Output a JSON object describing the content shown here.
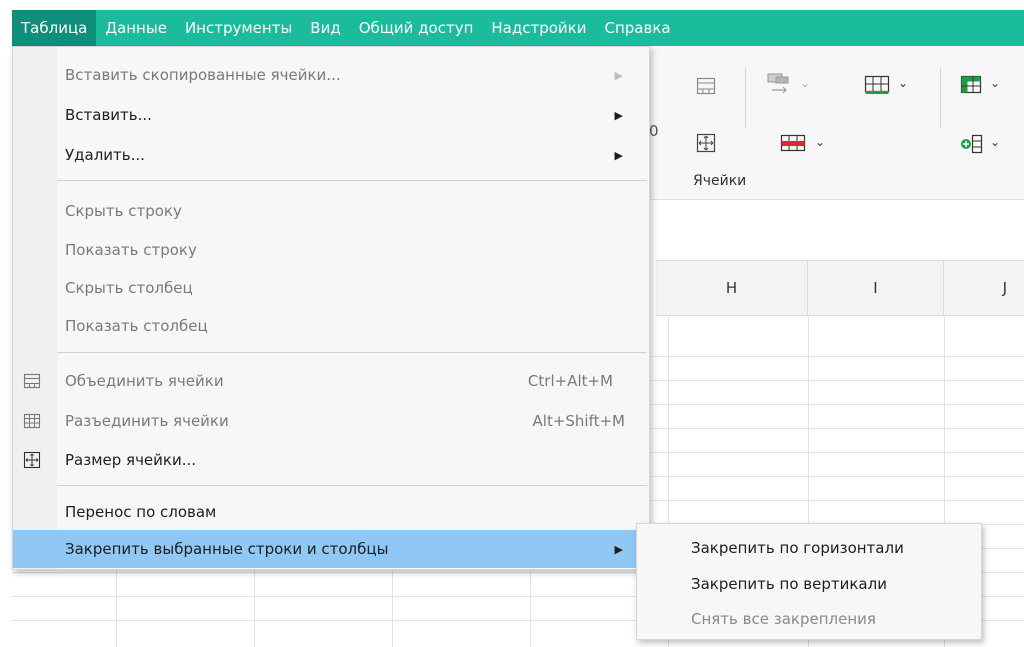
{
  "menubar": {
    "items": [
      "Таблица",
      "Данные",
      "Инструменты",
      "Вид",
      "Общий доступ",
      "Надстройки",
      "Справка"
    ],
    "accent": "#1abc9c",
    "active_color": "#0e8f7b"
  },
  "toolbar": {
    "group_label": "Ячейки",
    "stray_char": "0"
  },
  "grid": {
    "columns": [
      "H",
      "I",
      "J"
    ]
  },
  "menu": {
    "items": [
      {
        "label": "Вставить скопированные ячейки...",
        "disabled": true,
        "submenu": true
      },
      {
        "label": "Вставить...",
        "disabled": false,
        "submenu": true
      },
      {
        "label": "Удалить...",
        "disabled": false,
        "submenu": true
      },
      {
        "label": "Скрыть строку",
        "disabled": true
      },
      {
        "label": "Показать строку",
        "disabled": true
      },
      {
        "label": "Скрыть столбец",
        "disabled": true
      },
      {
        "label": "Показать столбец",
        "disabled": true
      },
      {
        "label": "Объединить ячейки",
        "shortcut": "Ctrl+Alt+M",
        "disabled": true,
        "icon": "merge-cells-icon"
      },
      {
        "label": "Разъединить ячейки",
        "shortcut": "Alt+Shift+M",
        "disabled": true,
        "icon": "unmerge-cells-icon"
      },
      {
        "label": "Размер ячейки...",
        "disabled": false,
        "icon": "cell-size-icon"
      },
      {
        "label": "Перенос по словам",
        "disabled": false
      },
      {
        "label": "Закрепить выбранные строки и столбцы",
        "disabled": false,
        "submenu": true,
        "highlighted": true
      }
    ],
    "highlight_color": "#8fc7f5"
  },
  "submenu": {
    "items": [
      {
        "label": "Закрепить по горизонтали",
        "disabled": false
      },
      {
        "label": "Закрепить по вертикали",
        "disabled": false
      },
      {
        "label": "Снять все закрепления",
        "disabled": true
      }
    ]
  }
}
